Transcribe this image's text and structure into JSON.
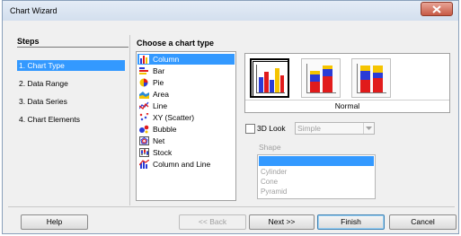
{
  "window": {
    "title": "Chart Wizard"
  },
  "steps": {
    "heading": "Steps",
    "items": [
      {
        "label": "1. Chart Type",
        "active": true
      },
      {
        "label": "2. Data Range",
        "active": false
      },
      {
        "label": "3. Data Series",
        "active": false
      },
      {
        "label": "4. Chart Elements",
        "active": false
      }
    ]
  },
  "chooser": {
    "heading": "Choose a chart type",
    "types": [
      {
        "label": "Column",
        "icon": "column-chart-icon",
        "selected": true
      },
      {
        "label": "Bar",
        "icon": "bar-chart-icon",
        "selected": false
      },
      {
        "label": "Pie",
        "icon": "pie-chart-icon",
        "selected": false
      },
      {
        "label": "Area",
        "icon": "area-chart-icon",
        "selected": false
      },
      {
        "label": "Line",
        "icon": "line-chart-icon",
        "selected": false
      },
      {
        "label": "XY (Scatter)",
        "icon": "scatter-chart-icon",
        "selected": false
      },
      {
        "label": "Bubble",
        "icon": "bubble-chart-icon",
        "selected": false
      },
      {
        "label": "Net",
        "icon": "net-chart-icon",
        "selected": false
      },
      {
        "label": "Stock",
        "icon": "stock-chart-icon",
        "selected": false
      },
      {
        "label": "Column and Line",
        "icon": "column-line-chart-icon",
        "selected": false
      }
    ],
    "variant_label": "Normal",
    "look_3d": {
      "label": "3D Look",
      "checked": false,
      "combo_value": "Simple"
    },
    "shape": {
      "label": "Shape",
      "options": [
        "",
        "Cylinder",
        "Cone",
        "Pyramid"
      ]
    }
  },
  "buttons": {
    "help": "Help",
    "back": "<< Back",
    "next": "Next >>",
    "finish": "Finish",
    "cancel": "Cancel"
  },
  "colors": {
    "selection": "#3399ff",
    "bar_blue": "#2a3bd6",
    "bar_red": "#e11b1b",
    "bar_yellow": "#f5c400"
  }
}
